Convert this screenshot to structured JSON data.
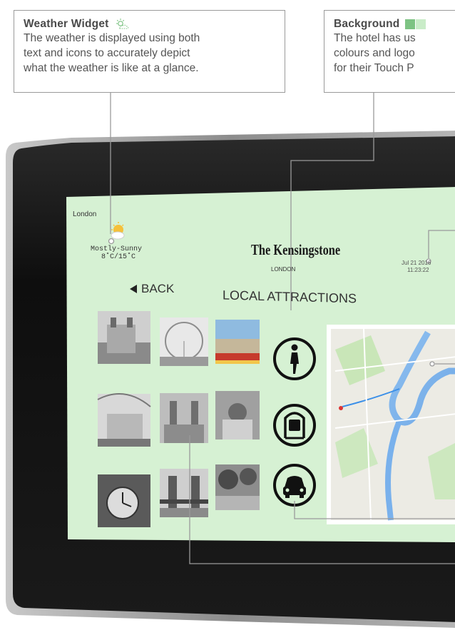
{
  "callouts": {
    "weather": {
      "title": "Weather Widget",
      "text_lines": [
        "The weather is displayed using both",
        "text and icons to accurately depict",
        "what the weather is like at a glance."
      ]
    },
    "background": {
      "title": "Background",
      "text_lines": [
        "The hotel has us",
        "colours and logo",
        "for their Touch P"
      ]
    }
  },
  "kiosk": {
    "location": "London",
    "weather": {
      "condition": "Mostly-Sunny",
      "temps": "8˚C/15˚C",
      "icon": "sun-cloud-icon"
    },
    "logo": {
      "name": "The Kensingstone",
      "subtitle": "LONDON"
    },
    "datetime": {
      "date": "Jul 21 2016",
      "time": "11:23:22"
    },
    "back_label": "BACK",
    "page_title": "LOCAL ATTRACTIONS",
    "attractions": [
      "tower-of-london",
      "london-eye",
      "buckingham-palace",
      "british-museum",
      "westminster-abbey",
      "st-pauls-cathedral",
      "big-ben",
      "tower-bridge",
      "hyde-park"
    ],
    "transport_icons": [
      "walking-icon",
      "underground-icon",
      "car-icon"
    ],
    "colors": {
      "screen": "#d6f1d3",
      "bezel": "#151515",
      "accent": "#7dc383"
    }
  }
}
